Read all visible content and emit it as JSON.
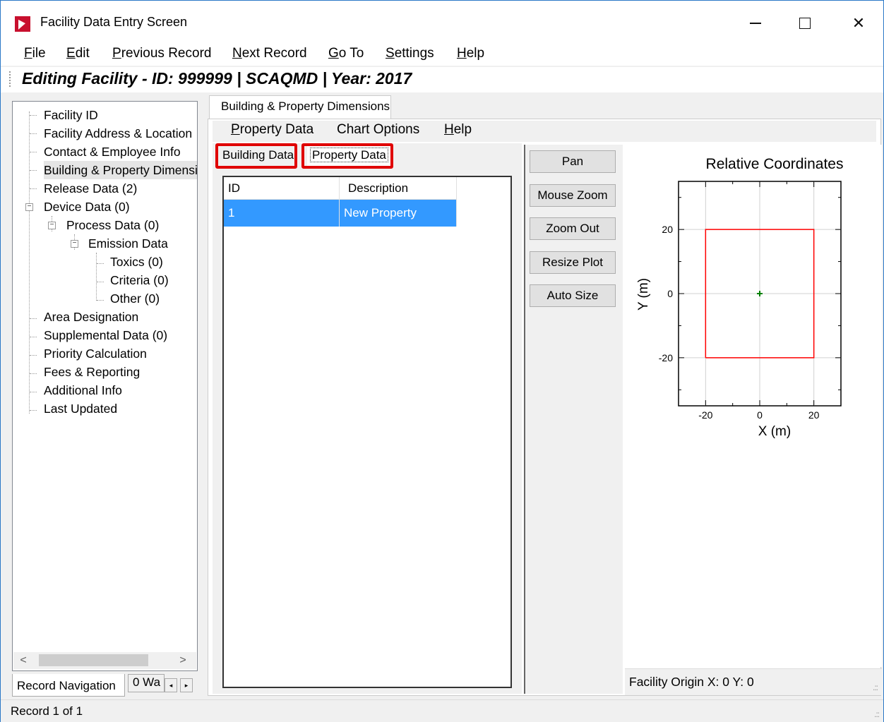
{
  "window": {
    "title": "Facility Data Entry Screen",
    "min_icon": "minimize-icon",
    "max_icon": "maximize-icon",
    "close_icon": "close-icon",
    "close_glyph": "✕"
  },
  "menu": {
    "file": {
      "ul": "F",
      "rest": "ile"
    },
    "edit": {
      "ul": "E",
      "rest": "dit"
    },
    "previous": {
      "ul": "P",
      "rest": "revious Record"
    },
    "next": {
      "ul": "N",
      "rest": "ext Record"
    },
    "goto": {
      "ul": "G",
      "rest": "o To"
    },
    "settings": {
      "ul": "S",
      "rest": "ettings"
    },
    "help": {
      "ul": "H",
      "rest": "elp"
    }
  },
  "header": {
    "editing_text": "Editing Facility - ID: 999999 | SCAQMD | Year: 2017"
  },
  "tree": {
    "items": [
      {
        "label": "Facility ID"
      },
      {
        "label": "Facility Address & Location"
      },
      {
        "label": "Contact & Employee Info"
      },
      {
        "label": "Building & Property Dimensi"
      },
      {
        "label": "Release Data (2)"
      },
      {
        "label": "Device Data (0)"
      },
      {
        "label": "Process Data (0)"
      },
      {
        "label": "Emission Data"
      },
      {
        "label": "Toxics (0)"
      },
      {
        "label": "Criteria (0)"
      },
      {
        "label": "Other (0)"
      },
      {
        "label": "Area Designation"
      },
      {
        "label": "Supplemental Data (0)"
      },
      {
        "label": "Priority Calculation"
      },
      {
        "label": "Fees & Reporting"
      },
      {
        "label": "Additional Info"
      },
      {
        "label": "Last Updated"
      }
    ],
    "scroll_left": "<",
    "scroll_right": ">"
  },
  "bottom_tabs": {
    "record_navigation": "Record Navigation",
    "second": "0 Wa",
    "scroll_left": "◂",
    "scroll_right": "▸"
  },
  "status": {
    "text": "Record 1 of 1",
    "grip": ".::"
  },
  "main_tab": {
    "label": "Building & Property Dimensions"
  },
  "inner_menu": {
    "property": {
      "ul": "P",
      "rest": "roperty Data"
    },
    "chart_options": "Chart Options",
    "help": {
      "ul": "H",
      "rest": "elp"
    }
  },
  "subtabs": {
    "building": "Building Data",
    "property": "Property Data"
  },
  "grid": {
    "columns": [
      "ID",
      "Description"
    ],
    "rows": [
      {
        "id": "1",
        "description": "New Property"
      }
    ]
  },
  "buttons": {
    "pan": "Pan",
    "mouse_zoom": "Mouse Zoom",
    "zoom_out": "Zoom Out",
    "resize_plot": "Resize Plot",
    "auto_size": "Auto Size"
  },
  "chart_data": {
    "type": "scatter",
    "title": "Relative Coordinates",
    "xlabel": "X (m)",
    "ylabel": "Y (m)",
    "xlim": [
      -30,
      30
    ],
    "ylim": [
      -35,
      35
    ],
    "xticks": [
      -20,
      0,
      20
    ],
    "yticks": [
      20,
      0,
      -20
    ],
    "grid": true,
    "series": [
      {
        "type": "polygon",
        "color": "#ff0000",
        "points": [
          [
            -20,
            -20
          ],
          [
            20,
            -20
          ],
          [
            20,
            20
          ],
          [
            -20,
            20
          ],
          [
            -20,
            -20
          ]
        ]
      },
      {
        "type": "marker",
        "color": "#008000",
        "marker": "+",
        "points": [
          [
            0,
            0
          ]
        ]
      }
    ]
  },
  "footer": {
    "origin_text": "Facility Origin  X:  0  Y:  0"
  }
}
